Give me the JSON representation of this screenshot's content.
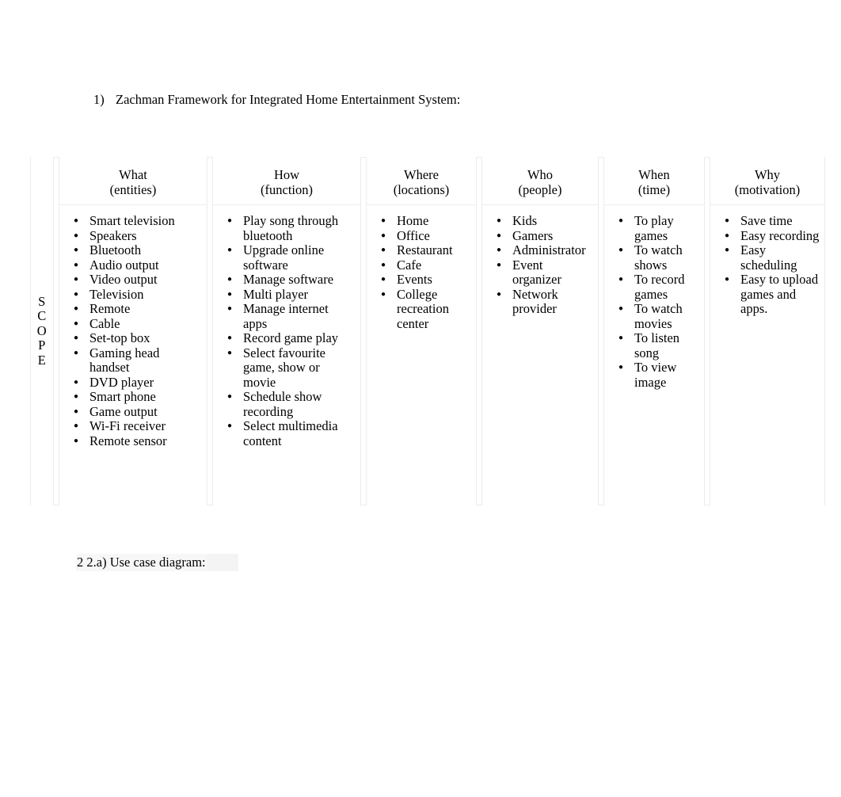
{
  "document": {
    "heading": {
      "number": "1)",
      "text": "Zachman Framework for Integrated Home Entertainment System:"
    },
    "subheading": {
      "text": "2 2.a) Use case diagram:"
    }
  },
  "table": {
    "row_label": {
      "name": "SCOPE",
      "letters": [
        "S",
        "C",
        "O",
        "P",
        "E"
      ]
    },
    "columns": [
      {
        "key": "what",
        "title": "What",
        "subtitle": "(entities)",
        "items": [
          "Smart television",
          "Speakers",
          "Bluetooth",
          "Audio output",
          "Video output",
          "Television",
          "Remote",
          "Cable",
          "Set-top box",
          "Gaming head handset",
          "DVD player",
          "Smart phone",
          "Game output",
          "Wi-Fi receiver",
          "Remote sensor"
        ]
      },
      {
        "key": "how",
        "title": "How",
        "subtitle": "(function)",
        "items": [
          "Play song through bluetooth",
          "Upgrade online software",
          "Manage software",
          "Multi player",
          "Manage internet apps",
          "Record game play",
          "Select favourite game, show or movie",
          "Schedule show recording",
          "Select multimedia content"
        ]
      },
      {
        "key": "where",
        "title": "Where",
        "subtitle": "(locations)",
        "items": [
          "Home",
          "Office",
          "Restaurant",
          "Cafe",
          "Events",
          "College recreation center"
        ]
      },
      {
        "key": "who",
        "title": "Who",
        "subtitle": "(people)",
        "items": [
          "Kids",
          "Gamers",
          "Administrator",
          "Event organizer",
          "Network provider"
        ]
      },
      {
        "key": "when",
        "title": "When",
        "subtitle": "(time)",
        "items": [
          "To play games",
          "To watch shows",
          "To record games",
          "To watch movies",
          "To listen song",
          "To view image"
        ]
      },
      {
        "key": "why",
        "title": "Why",
        "subtitle": "(motivation)",
        "items": [
          "Save time",
          "Easy recording",
          "Easy scheduling",
          "Easy to upload games and apps."
        ]
      }
    ]
  },
  "colors": {
    "page_background": "#ffffff",
    "text": "#000000",
    "table_border": "#ececec",
    "highlight": "#f4f4f4"
  }
}
